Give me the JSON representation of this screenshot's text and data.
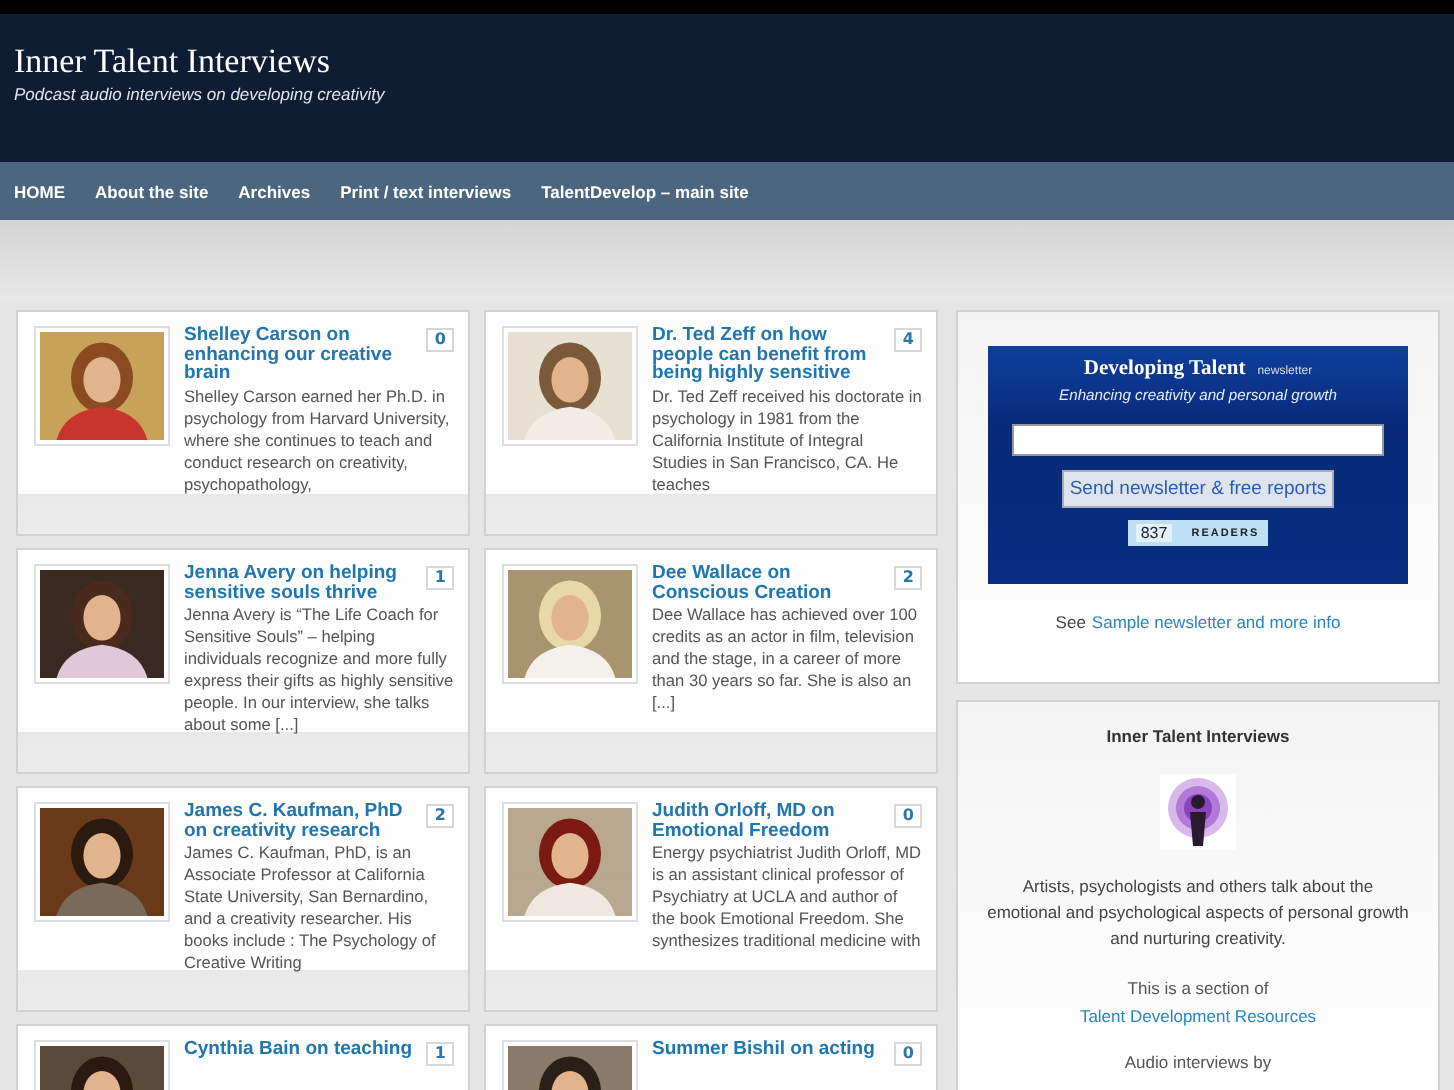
{
  "site": {
    "title": "Inner Talent Interviews",
    "tagline": "Podcast audio interviews on developing creativity"
  },
  "nav": [
    {
      "label": "HOME"
    },
    {
      "label": "About the site"
    },
    {
      "label": "Archives"
    },
    {
      "label": "Print / text interviews"
    },
    {
      "label": "TalentDevelop – main site"
    }
  ],
  "posts": [
    {
      "title": "Shelley Carson on enhancing our creative brain",
      "comments": "0",
      "excerpt": "Shelley Carson earned her Ph.D. in psychology from Harvard University, where she continues to teach and conduct research on creativity, psychopathology,"
    },
    {
      "title": "Dr. Ted Zeff on how people can benefit from being highly sensitive",
      "comments": "4",
      "excerpt": "Dr. Ted Zeff received his doctorate in psychology in 1981 from the California Institute of Integral Studies in San Francisco, CA. He teaches"
    },
    {
      "title": "Jenna Avery on helping sensitive souls thrive",
      "comments": "1",
      "excerpt": "Jenna Avery is “The Life Coach for Sensitive Souls” – helping individuals recognize and more fully express their gifts as highly sensitive people. In our interview, she talks about some [...]"
    },
    {
      "title": "Dee Wallace on Conscious Creation",
      "comments": "2",
      "excerpt": "Dee Wallace has achieved over 100 credits as an actor in film, television and the stage, in a career of more than 30 years so far. She is also an [...]"
    },
    {
      "title": "James C. Kaufman, PhD on creativity research",
      "comments": "2",
      "excerpt": "James C. Kaufman, PhD, is an Associate Professor at California State University, San Bernardino, and a creativity researcher. His books include : The Psychology of Creative Writing"
    },
    {
      "title": "Judith Orloff, MD on Emotional Freedom",
      "comments": "0",
      "excerpt": "Energy psychiatrist Judith Orloff, MD is an assistant clinical professor of Psychiatry at UCLA and author of the book Emotional Freedom. She synthesizes traditional medicine with"
    },
    {
      "title": "Cynthia Bain on teaching",
      "comments": "1"
    },
    {
      "title": "Summer Bishil on acting",
      "comments": "0"
    }
  ],
  "newsletter": {
    "title": "Developing Talent",
    "suffix": "newsletter",
    "subtitle": "Enhancing creativity and personal growth",
    "button": "Send newsletter & free reports",
    "readers_count": "837",
    "readers_label": "READERS",
    "see": "See",
    "link": "Sample newsletter and more info"
  },
  "about": {
    "title": "Inner Talent Interviews",
    "text": "Artists, psychologists and others talk about the emotional and psychological aspects of personal growth and nurturing creativity.",
    "section_text": "This is a section of",
    "section_link": "Talent Development Resources",
    "byline": "Audio interviews by"
  }
}
